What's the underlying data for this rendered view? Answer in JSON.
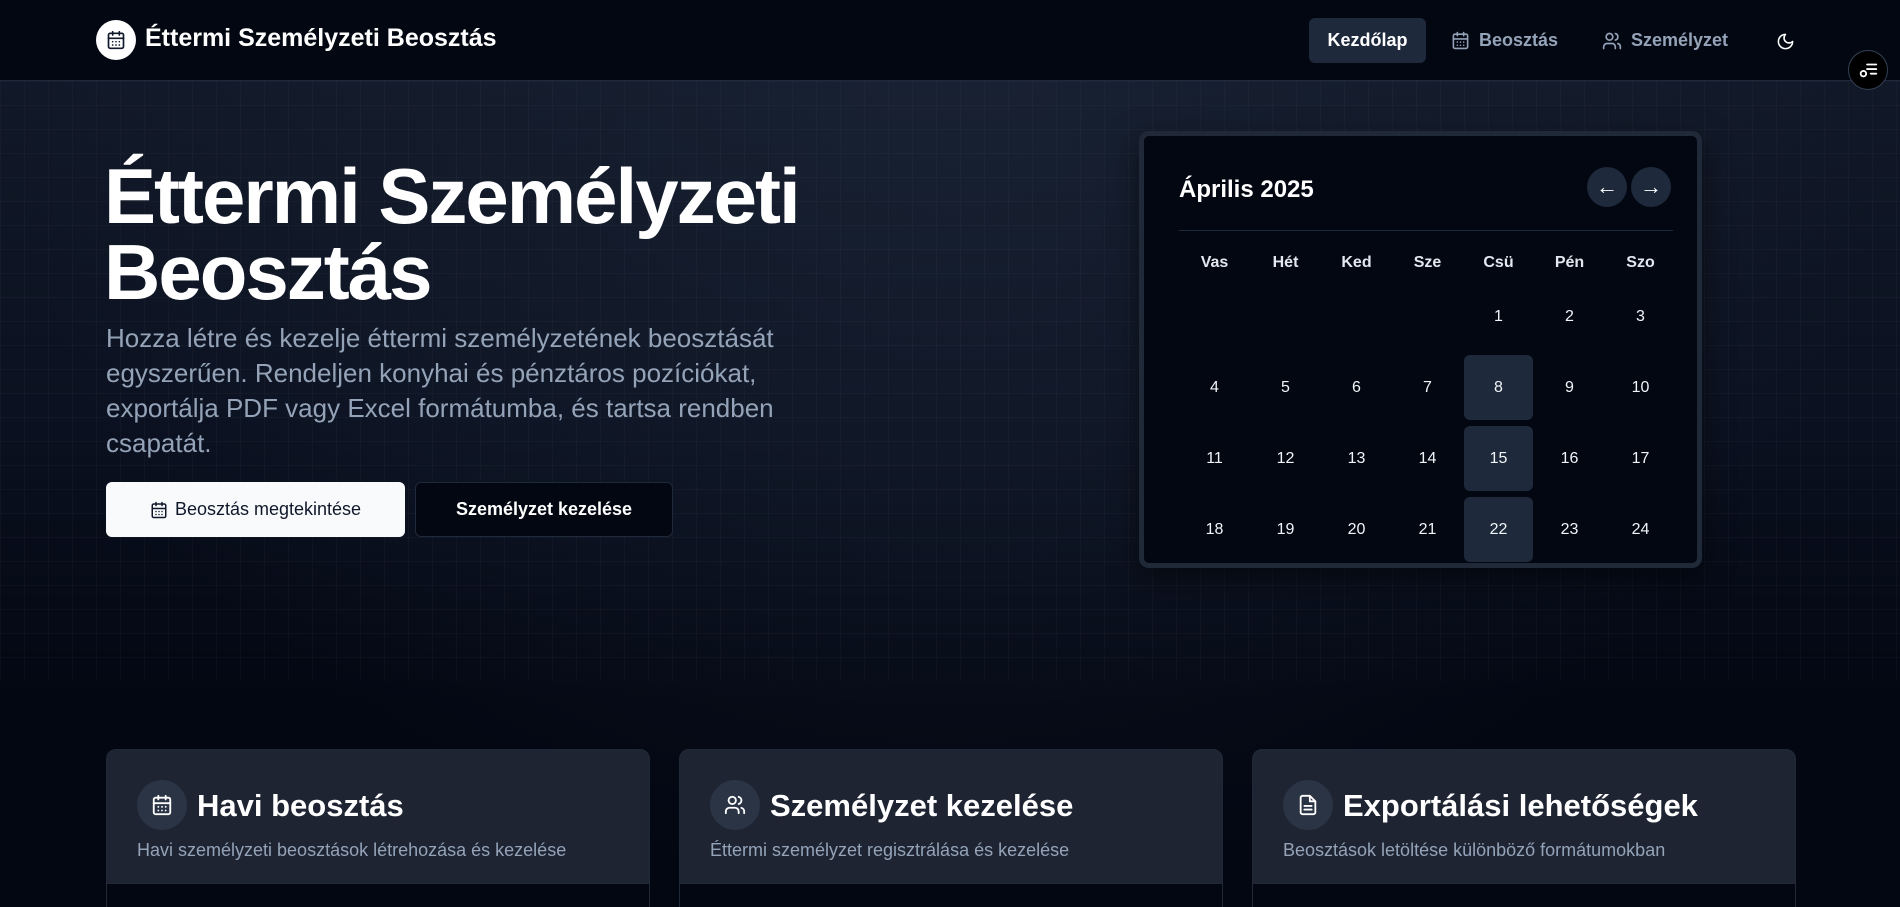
{
  "header": {
    "app_title": "Éttermi Személyzeti Beosztás",
    "nav": {
      "home": "Kezdőlap",
      "schedule": "Beosztás",
      "staff": "Személyzet"
    }
  },
  "hero": {
    "title": "Éttermi Személyzeti Beosztás",
    "description": "Hozza létre és kezelje éttermi személyzetének beosztását egyszerűen. Rendeljen konyhai és pénztáros pozíciókat, exportálja PDF vagy Excel formátumba, és tartsa rendben csapatát.",
    "primary_button": "Beosztás megtekintése",
    "secondary_button": "Személyzet kezelése"
  },
  "calendar": {
    "month_label": "Április 2025",
    "prev_label": "←",
    "next_label": "→",
    "weekdays": [
      "Vas",
      "Hét",
      "Ked",
      "Sze",
      "Csü",
      "Pén",
      "Szo"
    ],
    "weeks": [
      [
        "",
        "",
        "",
        "",
        "1",
        "2",
        "3"
      ],
      [
        "4",
        "5",
        "6",
        "7",
        "8",
        "9",
        "10"
      ],
      [
        "11",
        "12",
        "13",
        "14",
        "15",
        "16",
        "17"
      ],
      [
        "18",
        "19",
        "20",
        "21",
        "22",
        "23",
        "24"
      ]
    ],
    "highlighted_days": [
      "8",
      "15",
      "22"
    ]
  },
  "features": [
    {
      "icon": "calendar-icon",
      "title": "Havi beosztás",
      "description": "Havi személyzeti beosztások létrehozása és kezelése"
    },
    {
      "icon": "users-icon",
      "title": "Személyzet kezelése",
      "description": "Éttermi személyzet regisztrálása és kezelése"
    },
    {
      "icon": "file-icon",
      "title": "Exportálási lehetőségek",
      "description": "Beosztások letöltése különböző formátumokban"
    }
  ]
}
